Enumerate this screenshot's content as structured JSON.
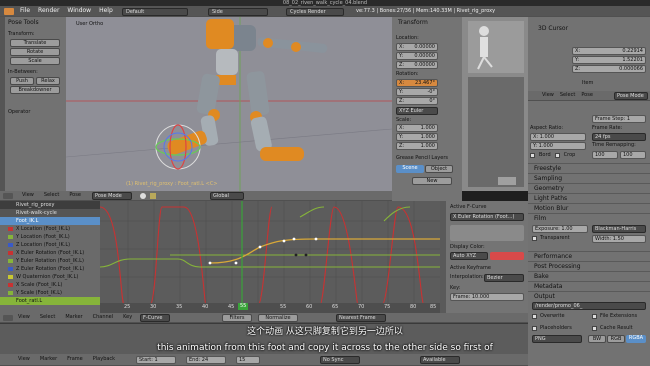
{
  "window": {
    "title": "08_02_riven_walk_cycle_04.blend"
  },
  "topbar": {
    "menus": [
      "File",
      "Render",
      "Window",
      "Help"
    ],
    "layout": "Default",
    "scene": "Side",
    "engine": "Cycles Render",
    "stats": "ve:77.3 | Bones:27/36 | Mem:140.33M | Rivet_rig_proxy"
  },
  "tools": {
    "title": "Pose Tools",
    "transform": "Transform:",
    "translate": "Translate",
    "rotate": "Rotate",
    "scale": "Scale",
    "inbetween": "In-Between:",
    "push": "Push",
    "relax": "Relax",
    "breakdowner": "Breakdowner",
    "operator": "Operator"
  },
  "viewport": {
    "view_label": "User Ortho",
    "object_label": "(1) Rivet_rig_proxy : Foot_ratl.L <C>",
    "menus": [
      "View",
      "Select",
      "Pose"
    ],
    "mode": "Pose Mode",
    "orientation": "Global"
  },
  "transform_panel": {
    "title": "Transform",
    "location": "Location:",
    "loc": [
      [
        "X:",
        "0.00000"
      ],
      [
        "Y:",
        "0.00000"
      ],
      [
        "Z:",
        "0.00000"
      ]
    ],
    "rotation": "Rotation:",
    "rot": [
      [
        "X:",
        "23.467°"
      ],
      [
        "Y:",
        "-0°"
      ],
      [
        "Z:",
        "0°"
      ]
    ],
    "euler": "XYZ Euler",
    "scale": "Scale:",
    "scl": [
      [
        "X:",
        "1.000"
      ],
      [
        "Y:",
        "1.000"
      ],
      [
        "Z:",
        "1.000"
      ]
    ],
    "grease": "Grease Pencil Layers",
    "scene_tab": "Scene",
    "object_tab": "Object",
    "new": "New"
  },
  "cursor_panel": {
    "title": "3D Cursor",
    "loc": [
      [
        "X:",
        "0.22914"
      ],
      [
        "Y:",
        "1.52201"
      ],
      [
        "Z:",
        "0.000066"
      ]
    ],
    "item": "Item"
  },
  "props": {
    "menus": [
      "View",
      "Select",
      "Pose"
    ],
    "mode": "Pose Mode",
    "frame_step": "Frame Step: 1",
    "aspect_ratio": "Aspect Ratio:",
    "ax": "X: 1.000",
    "ay": "Y: 1.000",
    "frame_rate": "Frame Rate:",
    "fps": "24 fps",
    "time_remap": "Time Remapping:",
    "t1": "100",
    "t2": "100",
    "border": "Bord",
    "crop": "Crop",
    "panels": [
      "Freestyle",
      "Sampling",
      "Geometry",
      "Light Paths",
      "Motion Blur",
      "Film"
    ],
    "exposure": "Exposure: 1.00",
    "filter": "Blackman-Harris",
    "transparent": "Transparent",
    "width": "Width: 1.50",
    "panels2": [
      "Performance",
      "Post Processing",
      "Bake",
      "Metadata",
      "Output"
    ],
    "output_path": "/render/promo_06_",
    "overwrite": "Overwrite",
    "file_ext": "File Extensions",
    "placeholders": "Placeholders",
    "cache": "Cache Result",
    "format": "PNG",
    "bw": "BW",
    "rgb": "RGB",
    "rgba": "RGBA"
  },
  "graph": {
    "channels": [
      "Rivet_rig_proxy",
      "Rivet-walk-cycle",
      "Foot_IK.L",
      "X Location (Foot_IK.L)",
      "Y Location (Foot_IK.L)",
      "Z Location (Foot_IK.L)",
      "X Euler Rotation (Foot_IK.L)",
      "Y Euler Rotation (Foot_IK.L)",
      "Z Euler Rotation (Foot_IK.L)",
      "W Quaternion (Foot_IK.L)",
      "X Scale (Foot_IK.L)",
      "Y Scale (Foot_IK.L)",
      "Foot_ratl.L"
    ],
    "ticks": [
      "25",
      "30",
      "35",
      "40",
      "45",
      "50",
      "55",
      "60",
      "65",
      "70",
      "75",
      "80",
      "85"
    ],
    "current_frame": "55",
    "menus": [
      "View",
      "Select",
      "Marker",
      "Channel",
      "Key"
    ],
    "mode": "F-Curve",
    "filters": "Filters",
    "pivot": "Normalize",
    "snap": "Nearest Frame"
  },
  "fcurve_panel": {
    "title": "Active F-Curve",
    "name": "X Euler Rotation (Foot...)",
    "display_color": "Display Color:",
    "color_mode": "Auto XYZ",
    "keyframe": "Active Keyframe",
    "interp": "Interpolation:",
    "interp_val": "Bezier",
    "key": "Key:",
    "frame": "Frame: 10.000"
  },
  "timeline": {
    "menus": [
      "View",
      "Marker",
      "Frame",
      "Playback"
    ],
    "start": "Start: 1",
    "end": "End: 24",
    "current": "15",
    "sync": "No Sync",
    "available": "Available"
  },
  "subtitles": {
    "zh": "这个动画 从这只脚复制它到另一边所以",
    "en": "this animation from this foot and copy it across to the other side so first of"
  },
  "colors": {
    "accent": "#d7893f",
    "channel_select": "#5a8fc8",
    "curve_red": "#c83232",
    "curve_green": "#86b43a",
    "curve_yellow": "#c8c832"
  }
}
